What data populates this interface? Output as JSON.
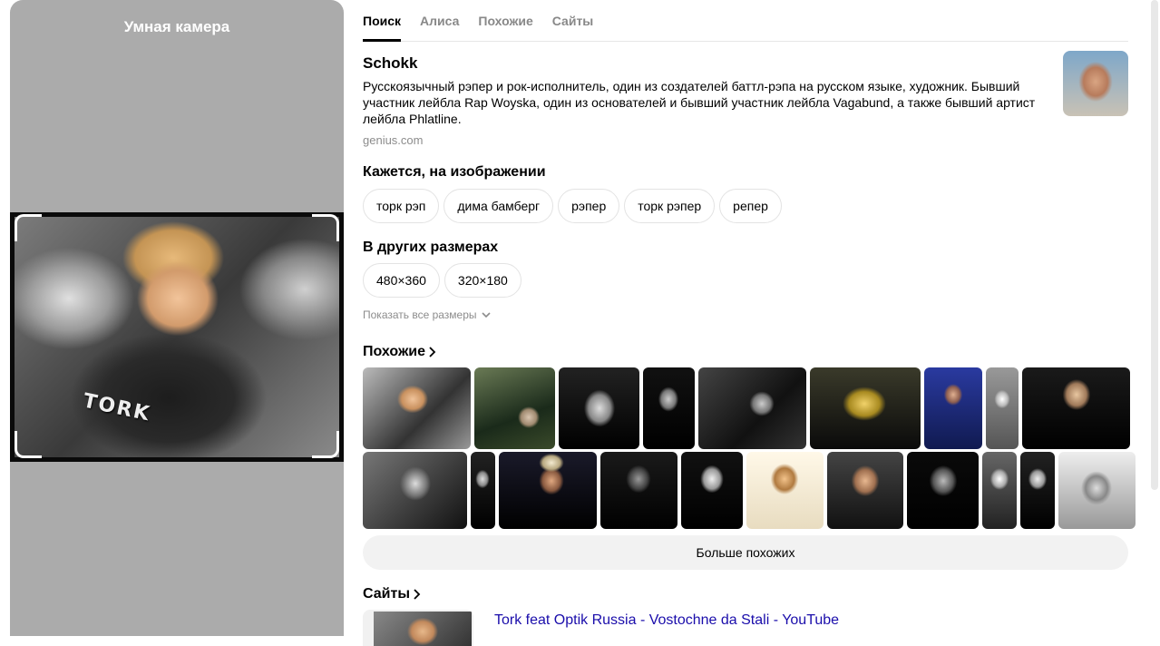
{
  "left": {
    "title": "Умная камера",
    "photo_text": "TORK"
  },
  "tabs": [
    {
      "label": "Поиск",
      "active": true
    },
    {
      "label": "Алиса",
      "active": false
    },
    {
      "label": "Похожие",
      "active": false
    },
    {
      "label": "Сайты",
      "active": false
    }
  ],
  "entity": {
    "title": "Schokk",
    "description": "Русскоязычный рэпер и рок-исполнитель, один из создателей баттл-рэпа на русском языке, художник. Бывший участник лейбла Rap Woyska, один из основателей и бывший участник лейбла Vagabund, а также бывший артист лейбла Phlatline.",
    "source": "genius.com"
  },
  "on_image": {
    "title": "Кажется, на изображении",
    "chips": [
      "торк рэп",
      "дима бамберг",
      "рэпер",
      "торк рэпер",
      "репер"
    ]
  },
  "sizes": {
    "title": "В других размерах",
    "chips": [
      "480×360",
      "320×180"
    ],
    "show_all": "Показать все размеры"
  },
  "similar": {
    "title": "Похожие",
    "more_button": "Больше похожих"
  },
  "sites": {
    "title": "Сайты",
    "first_link": "Tork feat Optik Russia - Vostochne da Stali - YouTube"
  }
}
